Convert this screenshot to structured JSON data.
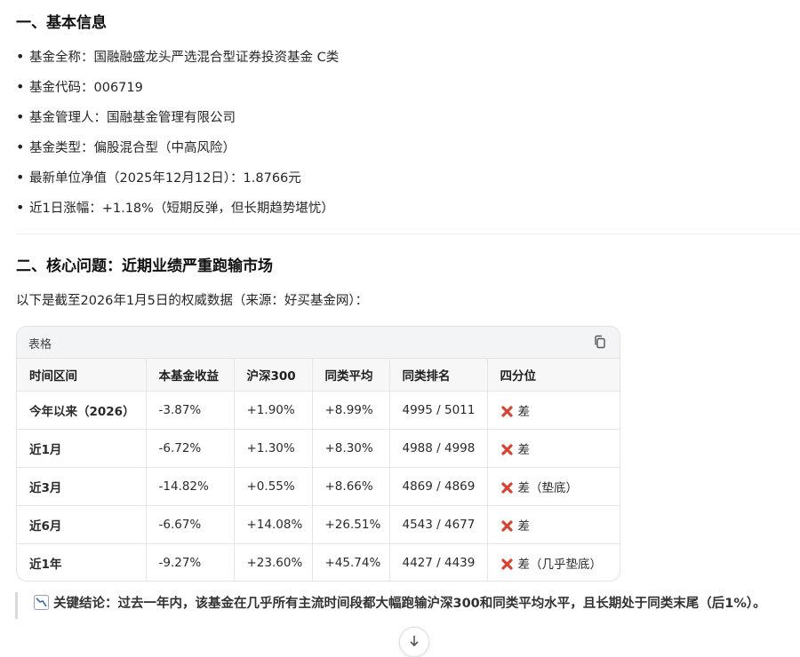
{
  "section1": {
    "title": "一、基本信息",
    "items": [
      "基金全称：国融融盛龙头严选混合型证券投资基金 C类",
      "基金代码：006719",
      "基金管理人：国融基金管理有限公司",
      "基金类型：偏股混合型（中高风险）",
      "最新单位净值（2025年12月12日）：1.8766元",
      "近1日涨幅：+1.18%（短期反弹，但长期趋势堪忧）"
    ]
  },
  "section2": {
    "title": "二、核心问题：近期业绩严重跑输市场",
    "intro": "以下是截至2026年1月5日的权威数据（来源：好买基金网）："
  },
  "table": {
    "card_label": "表格",
    "headers": [
      "时间区间",
      "本基金收益",
      "沪深300",
      "同类平均",
      "同类排名",
      "四分位"
    ],
    "rows": [
      [
        "今年以来（2026）",
        "-3.87%",
        "+1.90%",
        "+8.99%",
        "4995 / 5011",
        "差"
      ],
      [
        "近1月",
        "-6.72%",
        "+1.30%",
        "+8.30%",
        "4988 / 4998",
        "差"
      ],
      [
        "近3月",
        "-14.82%",
        "+0.55%",
        "+8.66%",
        "4869 / 4869",
        "差（垫底）"
      ],
      [
        "近6月",
        "-6.67%",
        "+14.08%",
        "+26.51%",
        "4543 / 4677",
        "差"
      ],
      [
        "近1年",
        "-9.27%",
        "+23.60%",
        "+45.74%",
        "4427 / 4439",
        "差（几乎垫底）"
      ]
    ]
  },
  "conclusion": {
    "text": "关键结论：过去一年内，该基金在几乎所有主流时间段都大幅跑输沪深300和同类平均水平，且长期处于同类末尾（后1%）。"
  },
  "colors": {
    "x_mark": "#d64533",
    "chart_icon": "#3a6ea5"
  }
}
